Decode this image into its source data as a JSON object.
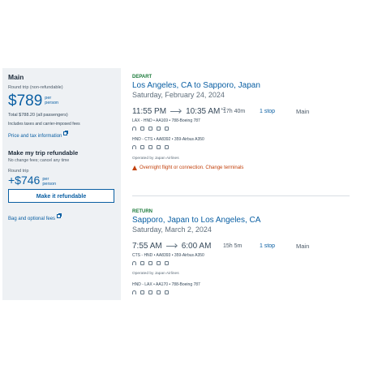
{
  "fare_panel": {
    "title": "Main",
    "trip_type": "Round trip (non-refundable)",
    "price": "$789",
    "per_label_line1": "per",
    "per_label_line2": "person",
    "total": "Total $788.20 (all passengers)",
    "taxes_note": "Includes taxes and carrier-imposed fees",
    "price_tax_link": "Price and tax information",
    "refundable_title": "Make my trip refundable",
    "refundable_sub": "No change fees; cancel any time",
    "refundable_trip_type": "Round trip",
    "refundable_price": "+$746",
    "refundable_button": "Make it refundable",
    "bag_link": "Bag and optional fees"
  },
  "depart": {
    "label": "DEPART",
    "route": "Los Angeles, CA to Sapporo, Japan",
    "date": "Saturday, February 24, 2024",
    "depart_time": "11:55 PM",
    "arrive_time": "10:35 AM",
    "day_offset": "+2",
    "duration": "17h 40m",
    "stops": "1 stop",
    "cabin": "Main",
    "segment1": "LAX - HND  •  AA169  •  788-Boeing 787",
    "segment2": "HND - CTS  •  AA8392  •  359-Airbus A350",
    "operated_by": "Operated by Japan Airlines",
    "warning": "Overnight flight or connection. Change terminals"
  },
  "return": {
    "label": "RETURN",
    "route": "Sapporo, Japan to Los Angeles, CA",
    "date": "Saturday, March 2, 2024",
    "depart_time": "7:55 AM",
    "arrive_time": "6:00 AM",
    "duration": "15h 5m",
    "stops": "1 stop",
    "cabin": "Main",
    "segment1": "CTS - HND  •  AA8393  •  359-Airbus A350",
    "operated_by": "Operated by Japan Airlines",
    "segment2": "HND - LAX  •  AA170  •  788-Boeing 787"
  },
  "icons": [
    "wifi-icon",
    "power-icon",
    "entertainment-icon",
    "meal-icon",
    "seat-icon"
  ],
  "colors": {
    "accent": "#0a5fa3",
    "depart_label": "#1b7a3a",
    "warning": "#c2410c",
    "panel_bg": "#eef1f4"
  }
}
